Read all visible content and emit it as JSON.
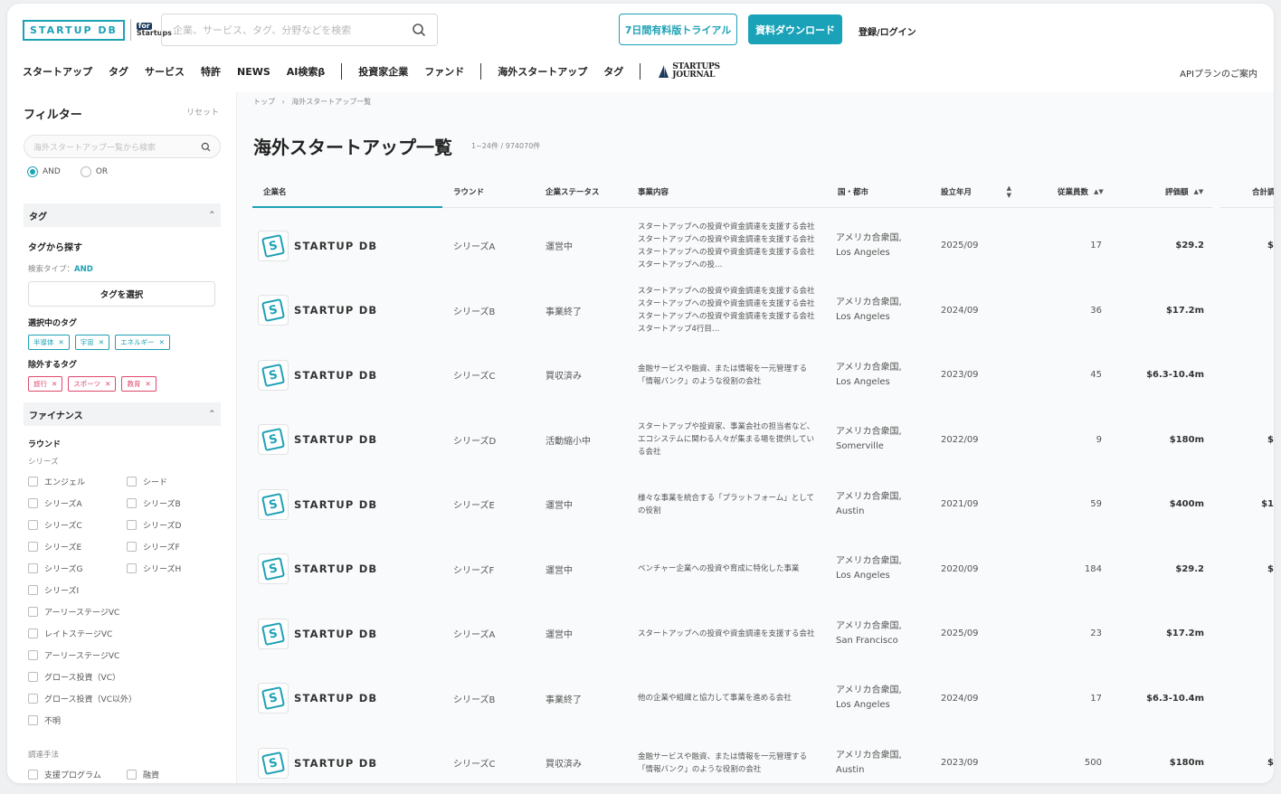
{
  "header": {
    "logo_text": "STARTUP DB",
    "logo_for": "for",
    "logo_sub": "Startups",
    "search_placeholder": "企業、サービス、タグ、分野などを検索",
    "trial_button": "7日間有料版トライアル",
    "download_button": "資料ダウンロード",
    "login": "登録/ログイン",
    "api_link": "APIプランのご案内",
    "accent_color": "#1da1b5"
  },
  "nav": {
    "group1": [
      "スタートアップ",
      "タグ",
      "サービス",
      "特許",
      "NEWS",
      "AI検索β"
    ],
    "group2": [
      "投資家企業",
      "ファンド"
    ],
    "group3": [
      "海外スタートアップ",
      "タグ"
    ],
    "journal_line1": "STARTUPS",
    "journal_line2": "JOURNAL"
  },
  "sidebar": {
    "title": "フィルター",
    "reset": "リセット",
    "search_placeholder": "海外スタートアップ一覧から検索",
    "mode_and": "AND",
    "mode_or": "OR",
    "tag_section": "タグ",
    "tag_find": "タグから探す",
    "search_type_label": "検索タイプ：",
    "search_type_value": "AND",
    "tag_select_button": "タグを選択",
    "selected_tags_label": "選択中のタグ",
    "selected_tags": [
      "半導体",
      "宇宙",
      "エネルギー"
    ],
    "excluded_tags_label": "除外するタグ",
    "excluded_tags": [
      "旅行",
      "スポーツ",
      "教育"
    ],
    "finance_section": "ファイナンス",
    "round_label": "ラウンド",
    "series_label": "シリーズ",
    "round_options": [
      "エンジェル",
      "シード",
      "シリーズA",
      "シリーズB",
      "シリーズC",
      "シリーズD",
      "シリーズE",
      "シリーズF",
      "シリーズG",
      "シリーズH",
      "シリーズI",
      "アーリーステージVC",
      "レイトステージVC",
      "アーリーステージVC",
      "グロース投資（VC）",
      "グロース投資（VC以外）",
      "不明"
    ],
    "funding_label": "調達手法",
    "funding_options": [
      "支援プログラム",
      "融資"
    ]
  },
  "main": {
    "breadcrumb_home": "トップ",
    "breadcrumb_sep": "›",
    "breadcrumb_current": "海外スタートアップ一覧",
    "title": "海外スタートアップ一覧",
    "count": "1~24件 / 974070件",
    "columns": {
      "company": "企業名",
      "round": "ラウンド",
      "status": "企業ステータス",
      "business": "事業内容",
      "location": "国・都市",
      "founded": "設立年月",
      "employees": "従業員数",
      "valuation": "評価額",
      "total": "合計調"
    },
    "rows": [
      {
        "name": "STARTUP DB",
        "round": "シリーズA",
        "status": "運営中",
        "desc": "スタートアップへの投資や資金調達を支援する会社スタートアップへの投資や資金調達を支援する会社スタートアップへの投資や資金調達を支援する会社スタートアップへの投…",
        "loc": "アメリカ合衆国, Los Angeles",
        "founded": "2025/09",
        "employees": "17",
        "valuation": "$29.2",
        "total": "$"
      },
      {
        "name": "STARTUP DB",
        "round": "シリーズB",
        "status": "事業終了",
        "desc": "スタートアップへの投資や資金調達を支援する会社スタートアップへの投資や資金調達を支援する会社スタートアップへの投資や資金調達を支援する会社スタートアップ4行目…",
        "loc": "アメリカ合衆国, Los Angeles",
        "founded": "2024/09",
        "employees": "36",
        "valuation": "$17.2m",
        "total": ""
      },
      {
        "name": "STARTUP DB",
        "round": "シリーズC",
        "status": "買収済み",
        "desc": "金融サービスや融資、または情報を一元管理する「情報バンク」のような役割の会社",
        "loc": "アメリカ合衆国, Los Angeles",
        "founded": "2023/09",
        "employees": "45",
        "valuation": "$6.3-10.4m",
        "total": ""
      },
      {
        "name": "STARTUP DB",
        "round": "シリーズD",
        "status": "活動縮小中",
        "desc": "スタートアップや投資家、事業会社の担当者など、エコシステムに関わる人々が集まる場を提供している会社",
        "loc": "アメリカ合衆国, Somerville",
        "founded": "2022/09",
        "employees": "9",
        "valuation": "$180m",
        "total": "$"
      },
      {
        "name": "STARTUP DB",
        "round": "シリーズE",
        "status": "運営中",
        "desc": "様々な事業を統合する「プラットフォーム」としての役割",
        "loc": "アメリカ合衆国, Austin",
        "founded": "2021/09",
        "employees": "59",
        "valuation": "$400m",
        "total": "$1"
      },
      {
        "name": "STARTUP DB",
        "round": "シリーズF",
        "status": "運営中",
        "desc": "ベンチャー企業への投資や育成に特化した事業",
        "loc": "アメリカ合衆国, Los Angeles",
        "founded": "2020/09",
        "employees": "184",
        "valuation": "$29.2",
        "total": "$"
      },
      {
        "name": "STARTUP DB",
        "round": "シリーズA",
        "status": "運営中",
        "desc": "スタートアップへの投資や資金調達を支援する会社",
        "loc": "アメリカ合衆国, San Francisco",
        "founded": "2025/09",
        "employees": "23",
        "valuation": "$17.2m",
        "total": ""
      },
      {
        "name": "STARTUP DB",
        "round": "シリーズB",
        "status": "事業終了",
        "desc": "他の企業や組織と協力して事業を進める会社",
        "loc": "アメリカ合衆国, Los Angeles",
        "founded": "2024/09",
        "employees": "17",
        "valuation": "$6.3-10.4m",
        "total": ""
      },
      {
        "name": "STARTUP DB",
        "round": "シリーズC",
        "status": "買収済み",
        "desc": "金融サービスや融資、または情報を一元管理する「情報バンク」のような役割の会社",
        "loc": "アメリカ合衆国, Austin",
        "founded": "2023/09",
        "employees": "500",
        "valuation": "$180m",
        "total": "$"
      }
    ]
  }
}
